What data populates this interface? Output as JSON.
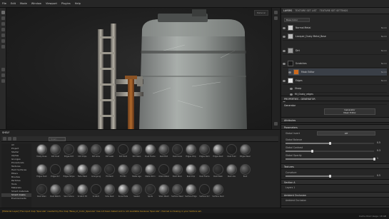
{
  "menu": [
    "File",
    "Edit",
    "Mode",
    "Window",
    "Viewport",
    "Plugins",
    "Help"
  ],
  "viewport": {
    "camera_label": "Material"
  },
  "right_panel": {
    "tabs": [
      "LAYERS",
      "TEXTURE SET LIST",
      "TEXTURE SET SETTINGS"
    ],
    "dropdown": "Base Color",
    "layers": [
      {
        "name": "Normal Metal",
        "blend": "Norm",
        "opacity": "100"
      },
      {
        "name": "Lacquer_Dusty Metal_Base",
        "blend": "Norm",
        "opacity": "100"
      },
      {
        "name": "Dirt",
        "blend": "Norm",
        "opacity": "100"
      },
      {
        "name": "Scratches",
        "blend": "Norm",
        "opacity": "100"
      },
      {
        "name": "Mask Editor",
        "blend": "Norm",
        "opacity": "100"
      },
      {
        "name": "Edges",
        "blend": "Norm",
        "opacity": "100"
      },
      {
        "name": "Sharp",
        "blend": "Norm",
        "opacity": "100"
      },
      {
        "name": "fill_Dusty_edges",
        "blend": "Norm",
        "opacity": "100"
      },
      {
        "name": "Fill",
        "blend": "Norm",
        "opacity": "100"
      }
    ],
    "properties_title": "PROPERTIES - GENERATOR",
    "generator_label": "Generator",
    "generator_name": "Mask Editor",
    "attributes_label": "Attributes",
    "parameters_label": "Parameters",
    "global_invert_label": "Global Invert",
    "global_invert_value": "Off",
    "props": [
      {
        "label": "Global Balance",
        "value": "0.5",
        "level": 0.5
      },
      {
        "label": "Global Contrast",
        "value": "0.3",
        "level": 0.3
      },
      {
        "label": "Global Opacity",
        "value": "1",
        "level": 1.0
      },
      {
        "label": "Curvature",
        "value": "0.7",
        "level": 0.7
      }
    ],
    "textures_label": "Textures",
    "texture_value": "0.5",
    "texture_level": 0.5,
    "section_a": "Section A",
    "section_b": "Ambient Occlusion",
    "ao_label": "Ambient Occlusion",
    "connections_label": "Connections",
    "layer_row_label": "Layers 1"
  },
  "shelf": {
    "title": "SHELF",
    "search_placeholder": "Smart...",
    "categories": [
      "All",
      "Project",
      "Starter",
      "Alphas",
      "Grunges",
      "Procedurals",
      "Textures",
      "Hard Surfaces",
      "Filters",
      "Brushes",
      "Particles",
      "Tools",
      "Materials",
      "Smart materials",
      "Smart masks",
      "Environments"
    ],
    "selected_category": "Smart masks",
    "rows": [
      [
        "Dusty Ruse",
        "Dirt Dust",
        "Edges Dirt",
        "Dirt Drips",
        "Dirt Grav",
        "Dirt Leak",
        "Dirt Mold",
        "Dirt Stain",
        "Dust Frame",
        "Dust Bird",
        "Dust Snow",
        "Edges Chip",
        "Edges Dam",
        "Edges Rust",
        "Dust Fuzz",
        "Edges Wear"
      ],
      [
        "Edges Dust",
        "Edges Scr",
        "Edges Stripe",
        "Fade Mask",
        "Grunge Lg",
        "Fill Paint",
        "Fill Mix",
        "Metal Age",
        "Metal Worn",
        "Oiled Metal",
        "Paint Worn",
        "Rust Drip",
        "Rust Frame",
        "Rust Mask",
        "Rust Lite",
        "Rust"
      ],
      [
        "Rust Stain",
        "Rust Watch",
        "Sand Stone",
        "Scratch Ed",
        "Scratch",
        "Side Dust",
        "Snow Fade",
        "Sealed",
        "Spots",
        "Stain Wash",
        "Surface Wear",
        "Surface Edge",
        "Surface Scr",
        "Surface Dust"
      ]
    ]
  },
  "status": {
    "message": "[Material Layer] The input map 'Specular' needed by the map 'Base_LY_Color_Specular' has not been baked and is not available because 'Specular' channel is missing in your texture set.",
    "fps": "Cache Disk Usage: 18 GB"
  },
  "colors": {
    "accent": "#d9a020",
    "panel_bg": "#262626",
    "viewport_bg": "#1f1f1f"
  }
}
